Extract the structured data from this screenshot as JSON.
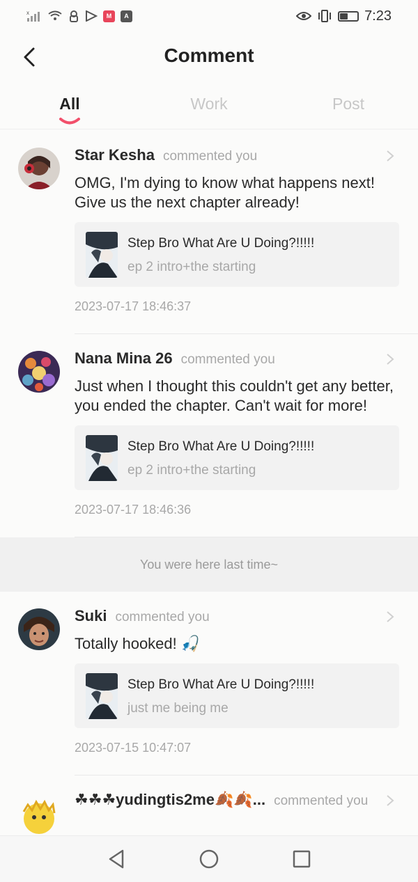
{
  "status_bar": {
    "time": "7:23",
    "left_icons": [
      "signal-icon",
      "wifi-icon",
      "vpn-icon",
      "play-icon",
      "manga-app-icon",
      "a-app-icon"
    ],
    "right_icons": [
      "eye-icon",
      "vibrate-icon",
      "battery-icon"
    ],
    "battery_level": 0.45
  },
  "header": {
    "title": "Comment"
  },
  "tabs": [
    {
      "label": "All",
      "active": true
    },
    {
      "label": "Work",
      "active": false
    },
    {
      "label": "Post",
      "active": false
    }
  ],
  "accent_color": "#f2506b",
  "comments": [
    {
      "username": "Star Kesha",
      "action": "commented you",
      "text": "OMG, I'm dying to know what happens next! Give us the next chapter already!",
      "work_title": "Step Bro What Are U Doing?!!!!!",
      "work_subtitle": "ep 2 intro+the starting",
      "timestamp": "2023-07-17 18:46:37"
    },
    {
      "username": "Nana Mina 26",
      "action": "commented you",
      "text": "Just when I thought this couldn't get any better, you ended the chapter. Can't wait for more!",
      "work_title": "Step Bro What Are U Doing?!!!!!",
      "work_subtitle": "ep 2 intro+the starting",
      "timestamp": "2023-07-17 18:46:36"
    },
    {
      "username": "Suki",
      "action": "commented you",
      "text": "Totally hooked! 🎣",
      "work_title": "Step Bro What Are U Doing?!!!!!",
      "work_subtitle": "just me being me",
      "timestamp": "2023-07-15 10:47:07"
    },
    {
      "username": "☘☘☘yudingtis2me🍂🍂...",
      "action": "commented you"
    }
  ],
  "last_time_marker": "You were here last time~"
}
